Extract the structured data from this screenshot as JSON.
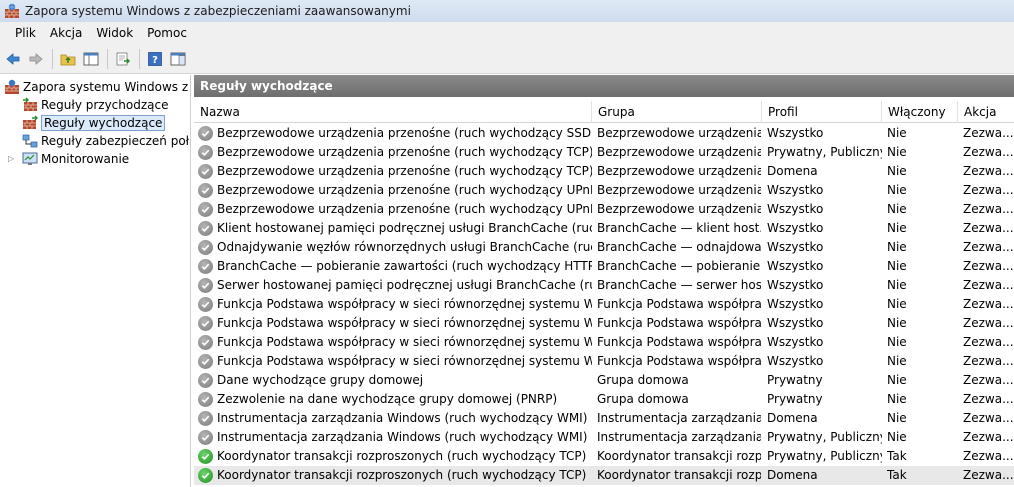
{
  "window": {
    "title": "Zapora systemu Windows z zabezpieczeniami zaawansowanymi"
  },
  "menu": {
    "items": [
      "Plik",
      "Akcja",
      "Widok",
      "Pomoc"
    ]
  },
  "tree": {
    "root": "Zapora systemu Windows z zab",
    "inbound": "Reguły przychodzące",
    "outbound": "Reguły wychodzące",
    "connection_security": "Reguły zabezpieczeń połącz",
    "monitoring": "Monitorowanie"
  },
  "main": {
    "header": "Reguły wychodzące",
    "columns": {
      "name": "Nazwa",
      "group": "Grupa",
      "profile": "Profil",
      "enabled": "Włączony",
      "action": "Akcja"
    },
    "rows": [
      {
        "name": "Bezprzewodowe urządzenia przenośne (ruch wychodzący SSDP)",
        "group": "Bezprzewodowe urządzenia ...",
        "profile": "Wszystko",
        "enabled": "Nie",
        "action": "Zezwa...",
        "on": false
      },
      {
        "name": "Bezprzewodowe urządzenia przenośne (ruch wychodzący TCP)",
        "group": "Bezprzewodowe urządzenia ...",
        "profile": "Prywatny, Publiczny",
        "enabled": "Nie",
        "action": "Zezwa...",
        "on": false
      },
      {
        "name": "Bezprzewodowe urządzenia przenośne (ruch wychodzący TCP)",
        "group": "Bezprzewodowe urządzenia ...",
        "profile": "Domena",
        "enabled": "Nie",
        "action": "Zezwa...",
        "on": false
      },
      {
        "name": "Bezprzewodowe urządzenia przenośne (ruch wychodzący UPnP)",
        "group": "Bezprzewodowe urządzenia ...",
        "profile": "Wszystko",
        "enabled": "Nie",
        "action": "Zezwa...",
        "on": false
      },
      {
        "name": "Bezprzewodowe urządzenia przenośne (ruch wychodzący UPnPHost)",
        "group": "Bezprzewodowe urządzenia ...",
        "profile": "Wszystko",
        "enabled": "Nie",
        "action": "Zezwa...",
        "on": false
      },
      {
        "name": "Klient hostowanej pamięci podręcznej usługi BranchCache (ruch wyc...",
        "group": "BranchCache — klient host...",
        "profile": "Wszystko",
        "enabled": "Nie",
        "action": "Zezwa...",
        "on": false
      },
      {
        "name": "Odnajdywanie węzłów równorzędnych usługi BranchCache (ruch wy...",
        "group": "BranchCache — odnajdowa...",
        "profile": "Wszystko",
        "enabled": "Nie",
        "action": "Zezwa...",
        "on": false
      },
      {
        "name": "BranchCache — pobieranie zawartości (ruch wychodzący HTTP)",
        "group": "BranchCache — pobieranie ...",
        "profile": "Wszystko",
        "enabled": "Nie",
        "action": "Zezwa...",
        "on": false
      },
      {
        "name": "Serwer hostowanej pamięci podręcznej usługi BranchCache (ruch wy...",
        "group": "BranchCache — serwer host...",
        "profile": "Wszystko",
        "enabled": "Nie",
        "action": "Zezwa...",
        "on": false
      },
      {
        "name": "Funkcja Podstawa współpracy w sieci równorzędnej systemu Windo...",
        "group": "Funkcja Podstawa współpra...",
        "profile": "Wszystko",
        "enabled": "Nie",
        "action": "Zezwa...",
        "on": false
      },
      {
        "name": "Funkcja Podstawa współpracy w sieci równorzędnej systemu Windo...",
        "group": "Funkcja Podstawa współpra...",
        "profile": "Wszystko",
        "enabled": "Nie",
        "action": "Zezwa...",
        "on": false
      },
      {
        "name": "Funkcja Podstawa współpracy w sieci równorzędnej systemu Windo...",
        "group": "Funkcja Podstawa współpra...",
        "profile": "Wszystko",
        "enabled": "Nie",
        "action": "Zezwa...",
        "on": false
      },
      {
        "name": "Funkcja Podstawa współpracy w sieci równorzędnej systemu Windo...",
        "group": "Funkcja Podstawa współpra...",
        "profile": "Wszystko",
        "enabled": "Nie",
        "action": "Zezwa...",
        "on": false
      },
      {
        "name": "Dane wychodzące grupy domowej",
        "group": "Grupa domowa",
        "profile": "Prywatny",
        "enabled": "Nie",
        "action": "Zezwa...",
        "on": false
      },
      {
        "name": "Zezwolenie na dane wychodzące grupy domowej (PNRP)",
        "group": "Grupa domowa",
        "profile": "Prywatny",
        "enabled": "Nie",
        "action": "Zezwa...",
        "on": false
      },
      {
        "name": "Instrumentacja zarządzania Windows (ruch wychodzący WMI)",
        "group": "Instrumentacja zarządzania ...",
        "profile": "Domena",
        "enabled": "Nie",
        "action": "Zezwa...",
        "on": false
      },
      {
        "name": "Instrumentacja zarządzania Windows (ruch wychodzący WMI)",
        "group": "Instrumentacja zarządzania ...",
        "profile": "Prywatny, Publiczny",
        "enabled": "Nie",
        "action": "Zezwa...",
        "on": false
      },
      {
        "name": "Koordynator transakcji rozproszonych (ruch wychodzący TCP)",
        "group": "Koordynator transakcji rozpr...",
        "profile": "Prywatny, Publiczny",
        "enabled": "Tak",
        "action": "Zezwa...",
        "on": true
      },
      {
        "name": "Koordynator transakcji rozproszonych (ruch wychodzący TCP)",
        "group": "Koordynator transakcji rozpr...",
        "profile": "Domena",
        "enabled": "Tak",
        "action": "Zezwa...",
        "on": true
      }
    ]
  }
}
